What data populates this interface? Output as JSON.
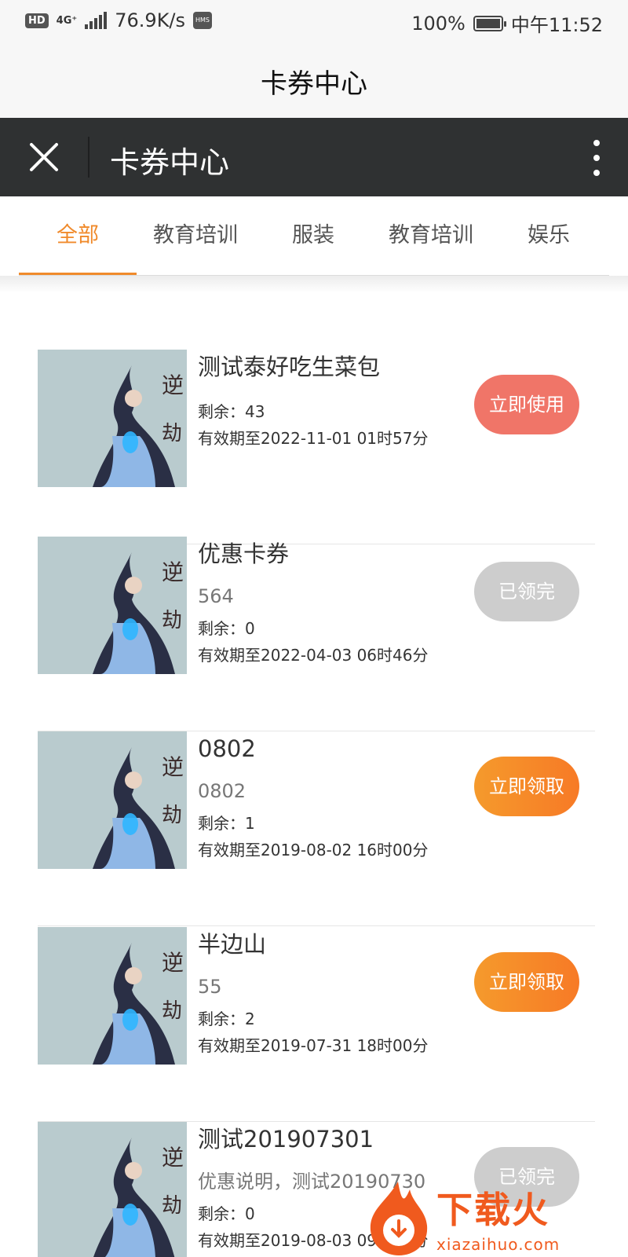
{
  "status_bar": {
    "hd": "HD",
    "network": "4G⁺",
    "speed": "76.9K/s",
    "hms": "HMS",
    "battery": "100%",
    "time": "中午11:52"
  },
  "page_title": "卡券中心",
  "header": {
    "title": "卡券中心"
  },
  "tabs": [
    {
      "label": "全部",
      "active": true
    },
    {
      "label": "教育培训",
      "active": false
    },
    {
      "label": "服装",
      "active": false
    },
    {
      "label": "教育培训",
      "active": false
    },
    {
      "label": "娱乐",
      "active": false
    }
  ],
  "coupons": [
    {
      "title": "测试泰好吃生菜包",
      "desc": "",
      "remain": "剩余：43",
      "expiry": "有效期至2022-11-01 01时57分",
      "action": "立即使用"
    },
    {
      "title": "优惠卡券",
      "desc": "564",
      "remain": "剩余：0",
      "expiry": "有效期至2022-04-03 06时46分",
      "action": "已领完"
    },
    {
      "title": "0802",
      "desc": "0802",
      "remain": "剩余：1",
      "expiry": "有效期至2019-08-02 16时00分",
      "action": "立即领取"
    },
    {
      "title": "半边山",
      "desc": "55",
      "remain": "剩余：2",
      "expiry": "有效期至2019-07-31 18时00分",
      "action": "立即领取"
    },
    {
      "title": "测试201907301",
      "desc": "优惠说明，测试20190730",
      "remain": "剩余：0",
      "expiry": "有效期至2019-08-03 09时27分",
      "action": "已领完"
    }
  ],
  "watermark": {
    "text": "下载火",
    "url": "xiazaihuo.com"
  },
  "colors": {
    "accent": "#f08a2b",
    "header_bg": "#2f3132",
    "btn_use": "#f07568",
    "btn_done": "#cdcdcd",
    "btn_claim": "#f77a26"
  }
}
